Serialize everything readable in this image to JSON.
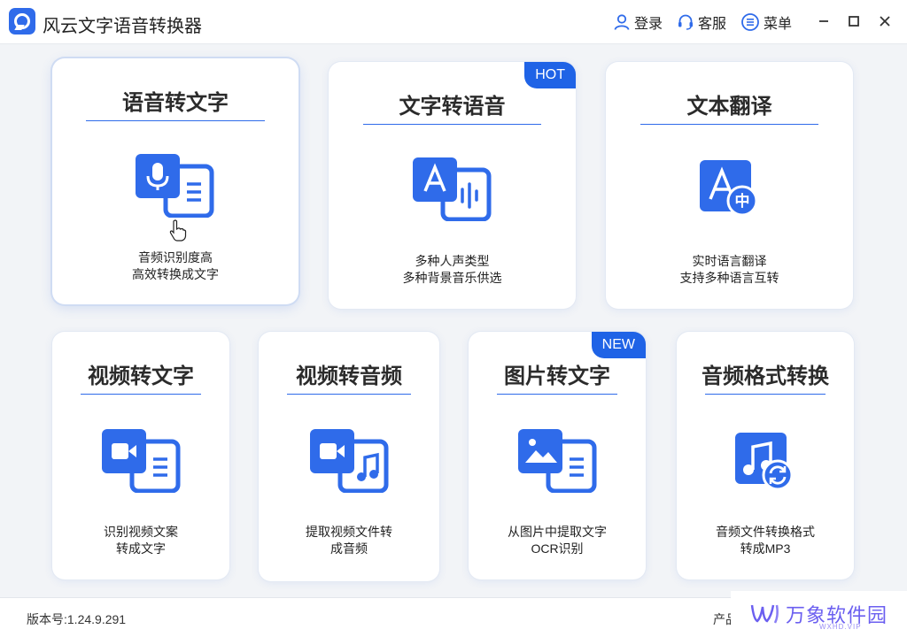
{
  "app": {
    "title": "风云文字语音转换器"
  },
  "titlebar": {
    "login": "登录",
    "service": "客服",
    "menu": "菜单"
  },
  "cards": [
    {
      "title": "语音转文字",
      "desc1": "音频识别度高",
      "desc2": "高效转换成文字",
      "icon": "mic-doc-icon"
    },
    {
      "title": "文字转语音",
      "desc1": "多种人声类型",
      "desc2": "多种背景音乐供选",
      "badge": "HOT",
      "icon": "text-to-speech-icon"
    },
    {
      "title": "文本翻译",
      "desc1": "实时语言翻译",
      "desc2": "支持多种语言互转",
      "icon": "translate-icon",
      "icon_glyph": "中"
    },
    {
      "title": "视频转文字",
      "desc1": "识别视频文案",
      "desc2": "转成文字",
      "icon": "video-doc-icon"
    },
    {
      "title": "视频转音频",
      "desc1": "提取视频文件转",
      "desc2": "成音频",
      "icon": "video-music-icon"
    },
    {
      "title": "图片转文字",
      "desc1": "从图片中提取文字",
      "desc2": "OCR识别",
      "badge": "NEW",
      "icon": "image-doc-icon"
    },
    {
      "title": "音频格式转换",
      "desc1": "音频文件转换格式",
      "desc2": "转成MP3",
      "icon": "music-convert-icon"
    }
  ],
  "footer": {
    "version": "版本号:1.24.9.291",
    "right_text": "产品"
  },
  "watermark": {
    "brand": "万象软件园",
    "url": "WXHD.VIP"
  },
  "colors": {
    "accent": "#2f6bea",
    "badge": "#1f63e6"
  }
}
